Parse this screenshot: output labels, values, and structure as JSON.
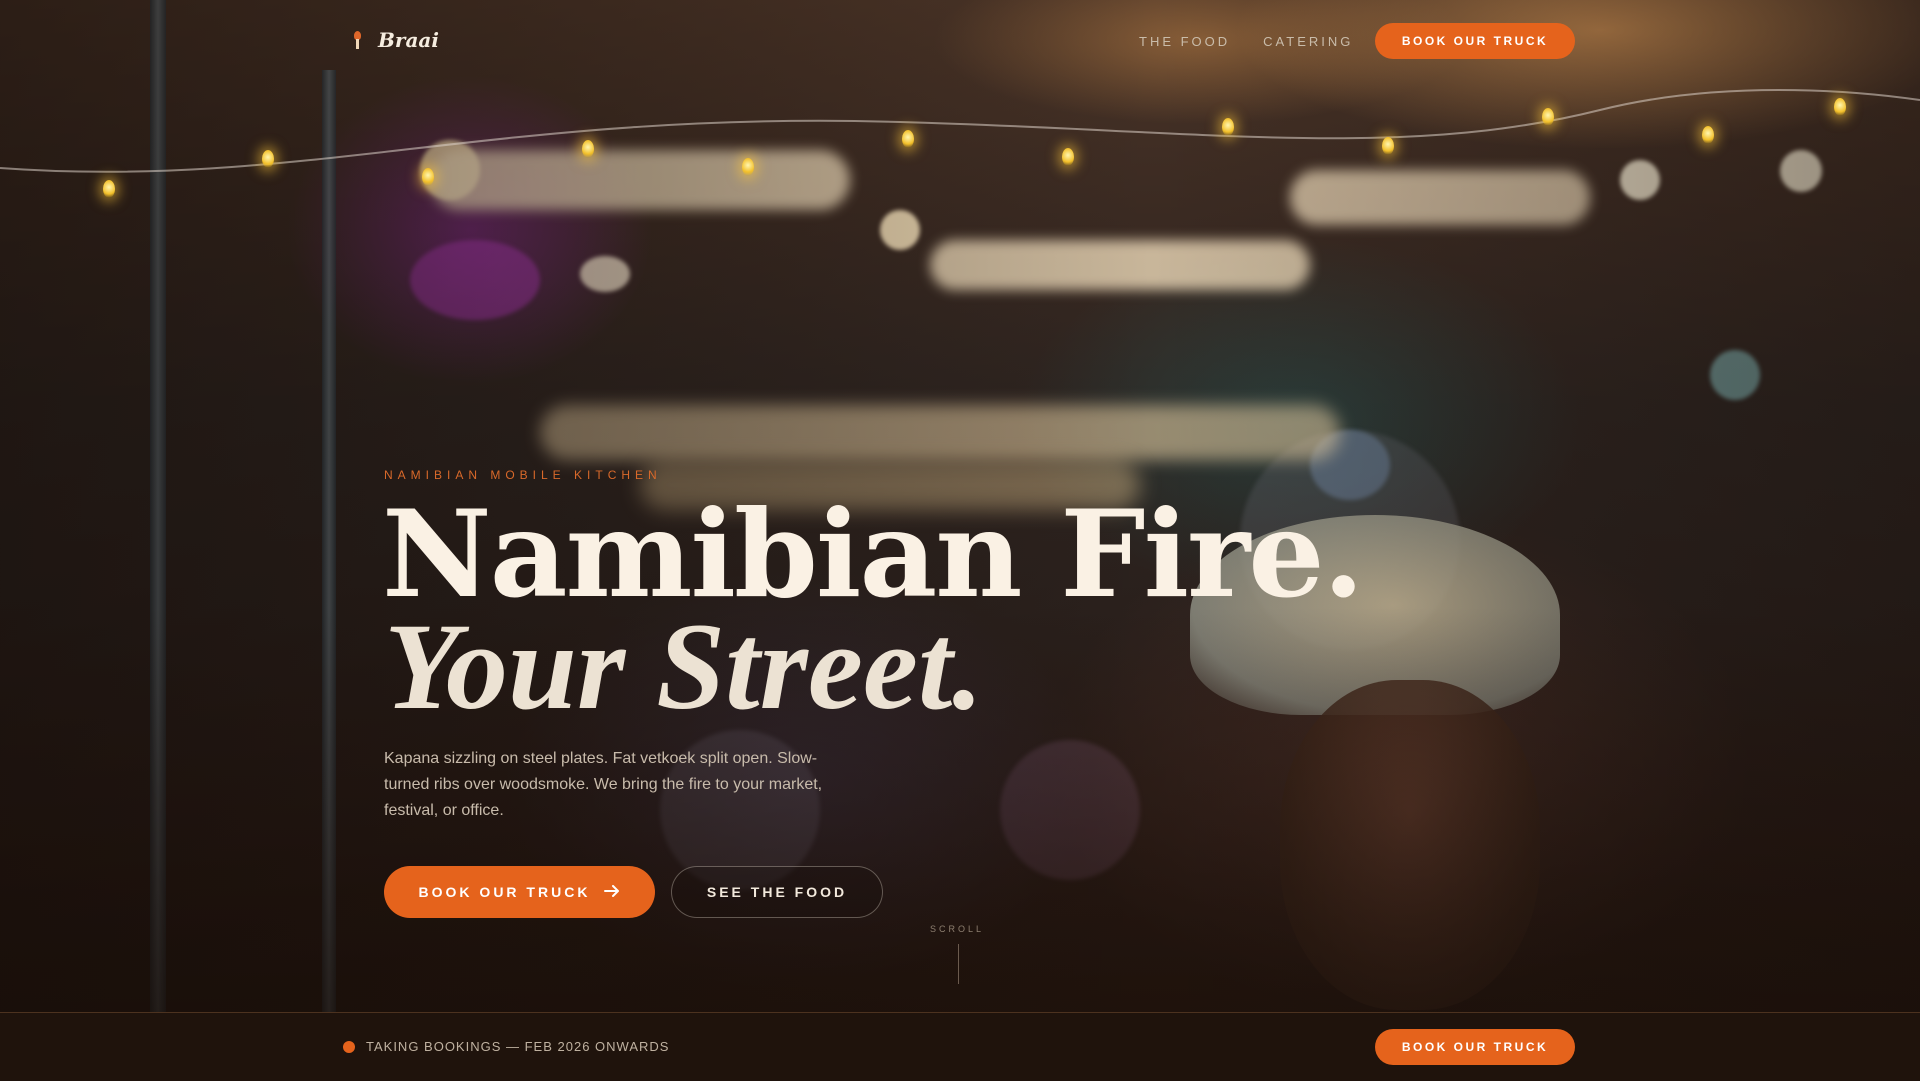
{
  "nav": {
    "brand": "Braai",
    "brand_icon": "skewer-flame-icon",
    "links": [
      {
        "label": "THE FOOD"
      },
      {
        "label": "CATERING"
      }
    ],
    "cta_label": "BOOK OUR TRUCK"
  },
  "hero": {
    "eyebrow": "NAMIBIAN MOBILE KITCHEN",
    "headline_line1": "Namibian Fire.",
    "headline_line2": "Your Street.",
    "description": "Kapana sizzling on steel plates. Fat vetkoek split open. Slow-turned ribs over woodsmoke. We bring the fire to your market, festival, or office.",
    "primary_button": "BOOK OUR TRUCK",
    "primary_button_icon": "arrow-right-icon",
    "secondary_button": "SEE THE FOOD",
    "scroll_hint": "SCROLL"
  },
  "bottom_bar": {
    "status": "TAKING BOOKINGS — FEB 2026 ONWARDS",
    "cta_label": "BOOK OUR TRUCK"
  },
  "colors": {
    "accent": "#e5631c",
    "background": "#1d120c",
    "text_primary": "#faf1e4",
    "text_muted": "#c8bbab"
  }
}
